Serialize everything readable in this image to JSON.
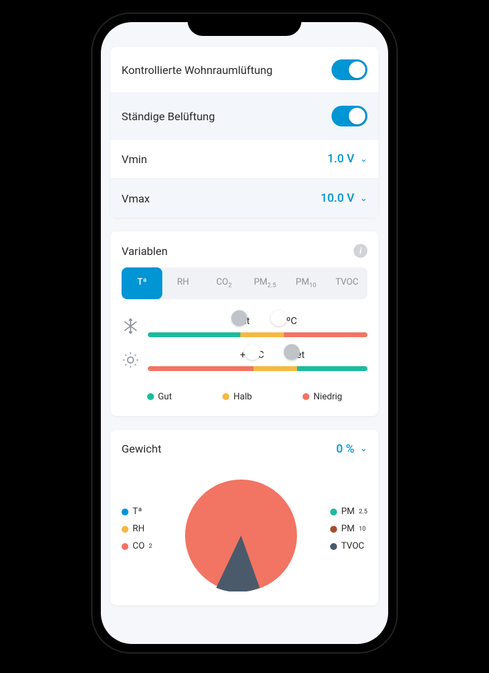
{
  "settings": {
    "controlled_vent_label": "Kontrollierte Wohnraumlüftung",
    "controlled_vent_on": true,
    "constant_vent_label": "Ständige Belüftung",
    "constant_vent_on": true,
    "vmin_label": "Vmin",
    "vmin_value": "1.0 V",
    "vmax_label": "Vmax",
    "vmax_value": "10.0 V"
  },
  "variables": {
    "title": "Variablen",
    "tabs": [
      "Tª",
      "RH",
      "CO2",
      "PM2.5",
      "PM10",
      "TVOC"
    ],
    "active_tab": 0,
    "cool": {
      "tset_label": "Tset",
      "offset_label": "+3 ºC"
    },
    "heat": {
      "offset_label": "+3 ºC",
      "tset_label": "Tset"
    },
    "legend": {
      "good": "Gut",
      "half": "Halb",
      "low": "Niedrig"
    }
  },
  "weight": {
    "title": "Gewicht",
    "value": "0 %",
    "legend_left": [
      {
        "label": "Tª",
        "color": "#0095d5"
      },
      {
        "label": "RH",
        "color": "#f5b942"
      },
      {
        "label": "CO2",
        "color": "#f27463"
      }
    ],
    "legend_right": [
      {
        "label": "PM2.5",
        "color": "#1abc9c"
      },
      {
        "label": "PM10",
        "color": "#a0522d"
      },
      {
        "label": "TVOC",
        "color": "#4a5a6a"
      }
    ]
  },
  "chart_data": {
    "type": "pie",
    "title": "Gewicht",
    "series": [
      {
        "name": "CO2",
        "value": 80,
        "color": "#f27463"
      },
      {
        "name": "TVOC",
        "value": 20,
        "color": "#4a5a6a"
      }
    ]
  }
}
